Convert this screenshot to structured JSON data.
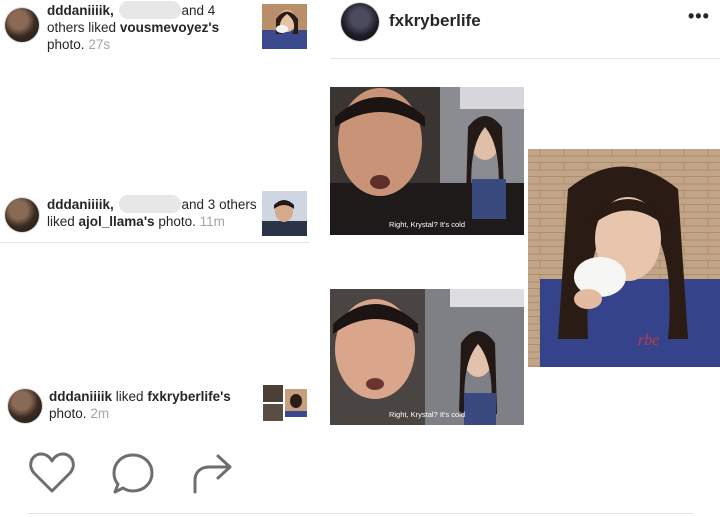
{
  "notifications": [
    {
      "user": "dddaniiiik,",
      "others": "and 4 others liked",
      "others_line1": "and 4",
      "others_line2": "others liked",
      "target": "vousmevoyez's",
      "tail": "photo.",
      "time": "27s"
    },
    {
      "user": "dddaniiiik,",
      "others_line1": "and 3 others",
      "others_line2": "liked",
      "target": "ajol_llama's",
      "tail": "photo.",
      "time": "11m"
    },
    {
      "user": "dddaniiiik",
      "middle": "liked",
      "target": "fxkryberlife's",
      "tail": "photo.",
      "time": "2m"
    }
  ],
  "post": {
    "username": "fxkryberlife",
    "more": "•••"
  },
  "frames": [
    {
      "caption": "Right, Krystal? It's cold"
    },
    {
      "caption": "Right, Krystal? It's cold"
    }
  ],
  "actions": {
    "like_icon": "heart-icon",
    "comment_icon": "comment-icon",
    "share_icon": "share-icon"
  },
  "colors": {
    "text": "#262626",
    "meta": "#a5a5a5",
    "divider": "#e6e6e6"
  }
}
